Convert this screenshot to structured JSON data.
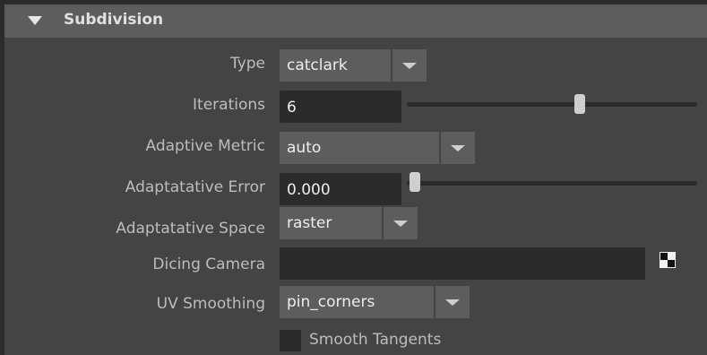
{
  "section": {
    "title": "Subdivision"
  },
  "type": {
    "label": "Type",
    "value": "catclark"
  },
  "iterations": {
    "label": "Iterations",
    "value": "6",
    "slider_level": 0.6
  },
  "adaptive_metric": {
    "label": "Adaptive Metric",
    "value": "auto"
  },
  "adaptative_error": {
    "label": "Adaptatative Error",
    "value": "0.000",
    "slider_level": 0.0
  },
  "adaptative_space": {
    "label": "Adaptatative Space",
    "value": "raster"
  },
  "dicing_camera": {
    "label": "Dicing Camera",
    "value": "",
    "icon": "checker-icon"
  },
  "uv_smoothing": {
    "label": "UV Smoothing",
    "value": "pin_corners"
  },
  "smooth_tangents": {
    "label": "Smooth Tangents",
    "checked": false
  }
}
